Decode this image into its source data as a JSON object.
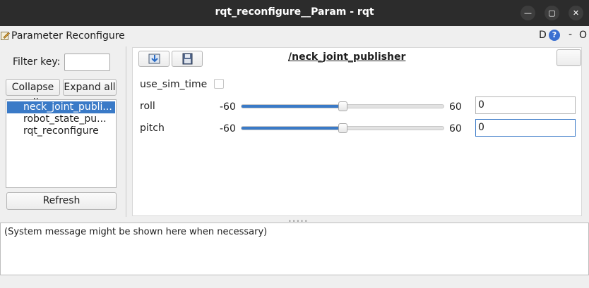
{
  "window": {
    "title": "rqt_reconfigure__Param - rqt",
    "controls": {
      "minimize": "minimize-icon",
      "maximize": "maximize-icon",
      "close": "close-icon"
    }
  },
  "plugin": {
    "title": "Parameter Reconfigure",
    "header_d": "D",
    "header_help": "?",
    "header_min": "-",
    "header_close": "O"
  },
  "sidebar": {
    "filter_label": "Filter key:",
    "filter_value": "",
    "collapse_label": "Collapse all",
    "expand_label": "Expand all",
    "nodes": [
      {
        "label": "neck_joint_publi...",
        "selected": true
      },
      {
        "label": "robot_state_pu...",
        "selected": false
      },
      {
        "label": "rqt_reconfigure",
        "selected": false
      }
    ],
    "refresh_label": "Refresh"
  },
  "panel": {
    "node_title": "/neck_joint_publisher",
    "params": {
      "use_sim_time": {
        "label": "use_sim_time",
        "checked": false
      },
      "roll": {
        "label": "roll",
        "min": "-60",
        "max": "60",
        "value": "0",
        "level": 0.5
      },
      "pitch": {
        "label": "pitch",
        "min": "-60",
        "max": "60",
        "value": "0",
        "level": 0.5
      }
    }
  },
  "console": {
    "message": "(System message might be shown here when necessary)"
  },
  "colors": {
    "accent": "#3a7ac7",
    "titlebar": "#2c2c2c"
  }
}
